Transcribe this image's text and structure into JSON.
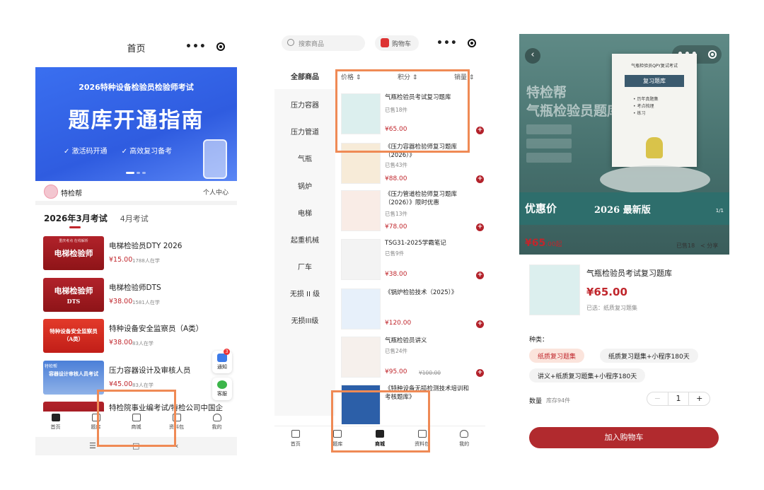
{
  "phone1": {
    "title": "首页",
    "banner": {
      "subtitle": "2026特种设备检验员检验师考试",
      "title": "题库开通指南",
      "tags": [
        "激活码开通",
        "高效复习备考"
      ]
    },
    "brand": "特检帮",
    "user_center": "个人中心",
    "exam_tabs": [
      "2026年3月考试",
      "4月考试"
    ],
    "courses": [
      {
        "title": "电梯检验员DTY 2026",
        "price": "¥15.00",
        "students": "1788人在学",
        "thumb": "电梯检验师",
        "thumb_sub": "重庆考点 在线解析"
      },
      {
        "title": "电梯检验师DTS",
        "price": "¥38.00",
        "students": "1581人在学",
        "thumb": "电梯检验师",
        "thumb_sub": "DTS"
      },
      {
        "title": "特种设备安全监察员（A类）",
        "price": "¥38.00",
        "students": "83人在学",
        "thumb": "特种设备安全监察员（A类）",
        "thumb_sub": ""
      },
      {
        "title": "压力容器设计及审核人员",
        "price": "¥45.00",
        "students": "83人在学",
        "thumb": "容器设计审核人员考试",
        "thumb_sub": "特检帮"
      },
      {
        "title": "特检院事业编考试/特检公司中国企",
        "price": "",
        "students": "",
        "thumb": "",
        "thumb_sub": ""
      }
    ],
    "float_buttons": {
      "notify": "通知",
      "notify_badge": "3",
      "service": "客服"
    },
    "tabs": [
      "首页",
      "题库",
      "商城",
      "资料包",
      "我的"
    ],
    "nav": [
      "☰",
      "□",
      "‹"
    ]
  },
  "phone2": {
    "search_placeholder": "搜索商品",
    "cart": "购物车",
    "categories": [
      "全部商品",
      "压力容器",
      "压力管道",
      "气瓶",
      "锅炉",
      "电梯",
      "起重机械",
      "厂车",
      "无损 II 级",
      "无损III级"
    ],
    "sorts": [
      "价格 ⇕",
      "积分 ⇕",
      "销量 ⇕"
    ],
    "products": [
      {
        "title": "气瓶检验员考试复习题库",
        "sold": "已售18件",
        "price": "¥65.00",
        "old": ""
      },
      {
        "title": "《压力容器检验师复习题库（2026）》",
        "sold": "已售43件",
        "price": "¥88.00",
        "old": ""
      },
      {
        "title": "《压力管道检验师复习题库（2026）》限时优惠",
        "sold": "已售13件",
        "price": "¥78.00",
        "old": ""
      },
      {
        "title": "TSG31-2025学霸笔记",
        "sold": "已售9件",
        "price": "¥38.00",
        "old": ""
      },
      {
        "title": "《锅炉检验技术（2025）》",
        "sold": "",
        "price": "¥120.00",
        "old": ""
      },
      {
        "title": "气瓶检验员讲义",
        "sold": "已售24件",
        "price": "¥95.00",
        "old": "¥100.00"
      },
      {
        "title": "《特种设备无损检测技术培训和考核题库》",
        "sold": "",
        "price": "",
        "old": ""
      }
    ],
    "tabs": [
      "首页",
      "题库",
      "商城",
      "资料包",
      "我的"
    ]
  },
  "phone3": {
    "hero": {
      "title_line1": "特检帮",
      "title_line2": "气瓶检验员题库",
      "book_series": "气瓶检验员QPY复试考试",
      "book_title": "复习题库",
      "book_lines": [
        "• 历年真题集",
        "• 考点梳理",
        "• 练习"
      ],
      "promo": "优惠价",
      "edition": "2026 最新版",
      "page": "1/1",
      "price": "¥65",
      "price_suffix": ".00起",
      "sold": "已售18",
      "share": "分享"
    },
    "sheet": {
      "title": "气瓶检验员考试复习题库",
      "price": "¥65.00",
      "selected": "已选：纸质复习题集",
      "kind_label": "种类：",
      "options": [
        "纸质复习题集",
        "纸质复习题集+小程序180天",
        "讲义+纸质复习题集+小程序180天"
      ],
      "qty_label": "数量",
      "stock": "库存94件",
      "qty": "1",
      "minus": "−",
      "plus": "+",
      "add_to_cart": "加入购物车"
    }
  },
  "colors": {
    "accent": "#c0262c",
    "highlight": "#ef8a55",
    "banner": "#3a6ff0"
  }
}
